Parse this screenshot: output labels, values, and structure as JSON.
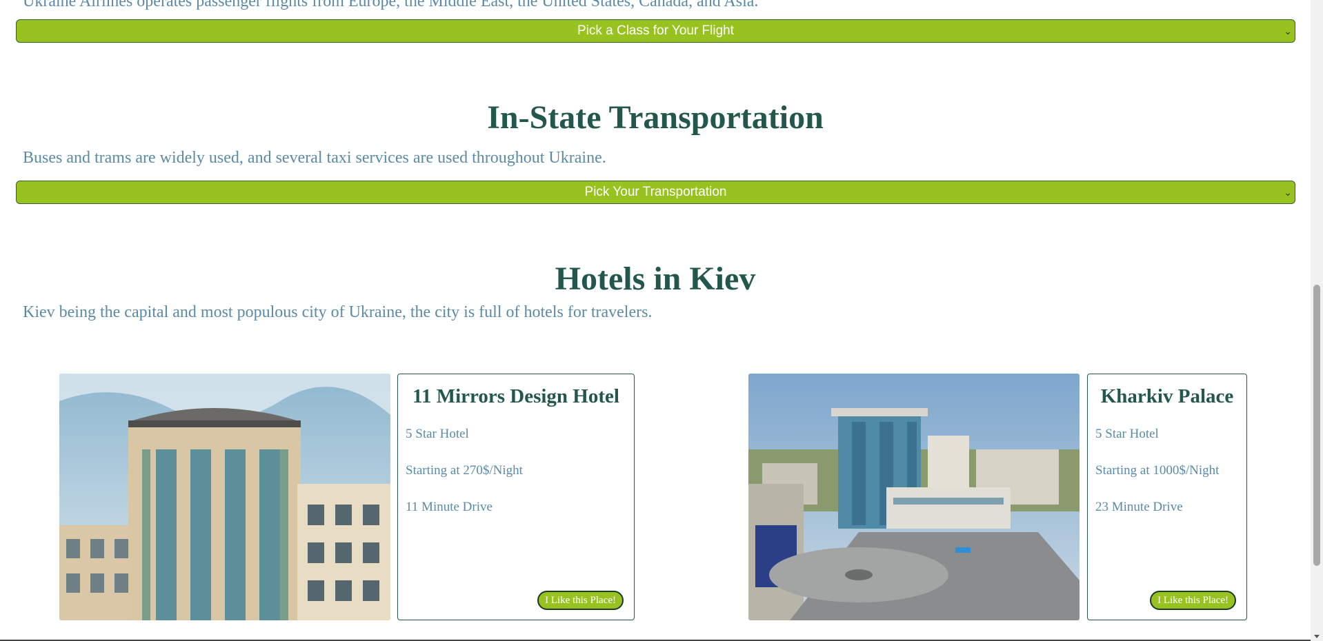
{
  "flights": {
    "cut_text": "Ukraine Airlines operates passenger flights from Europe, the Middle East, the United States, Canada, and Asia.",
    "select_value": "Pick a Class for Your Flight"
  },
  "transport": {
    "title": "In-State Transportation",
    "text": "Buses and trams are widely used, and several taxi services are used throughout Ukraine.",
    "select_value": "Pick Your Transportation"
  },
  "hotels": {
    "title": "Hotels in Kiev",
    "text": "Kiev being the capital and most populous city of Ukraine, the city is full of hotels for travelers.",
    "items": [
      {
        "name": "11 Mirrors Design Hotel",
        "stars": "5 Star Hotel",
        "price": "Starting at 270$/Night",
        "drive": "11 Minute Drive",
        "button": "I Like this Place!"
      },
      {
        "name": "Kharkiv Palace",
        "stars": "5 Star Hotel",
        "price": "Starting at 1000$/Night",
        "drive": "23 Minute Drive",
        "button": "I Like this Place!"
      }
    ]
  },
  "colors": {
    "accent_green": "#98c21f",
    "heading": "#23574e",
    "body_text": "#5b8aa6"
  }
}
